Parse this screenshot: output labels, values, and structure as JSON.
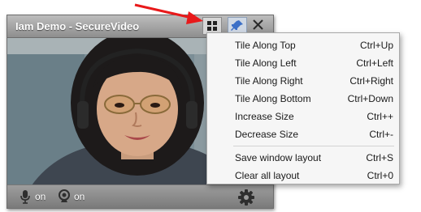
{
  "window": {
    "title": "Iam Demo - SecureVideo"
  },
  "titlebar_icons": {
    "tile": "tile-layout-icon",
    "pin": "pin-icon",
    "close": "close-icon"
  },
  "bottombar": {
    "mic_label": "on",
    "camera_label": "on",
    "icons": [
      "microphone-icon",
      "webcam-icon",
      "gear-icon"
    ]
  },
  "menu": {
    "items": [
      {
        "label": "Tile Along Top",
        "shortcut": "Ctrl+Up"
      },
      {
        "label": "Tile Along Left",
        "shortcut": "Ctrl+Left"
      },
      {
        "label": "Tile Along Right",
        "shortcut": "Ctrl+Right"
      },
      {
        "label": "Tile Along Bottom",
        "shortcut": "Ctrl+Down"
      },
      {
        "label": "Increase Size",
        "shortcut": "Ctrl++"
      },
      {
        "label": "Decrease Size",
        "shortcut": "Ctrl+-"
      },
      {
        "label": "Save window layout",
        "shortcut": "Ctrl+S"
      },
      {
        "label": "Clear all layout",
        "shortcut": "Ctrl+0"
      }
    ]
  },
  "colors": {
    "annotation_arrow": "#e8191a",
    "menu_background": "#f6f6f6",
    "pin_accent": "#3b6fc7"
  }
}
